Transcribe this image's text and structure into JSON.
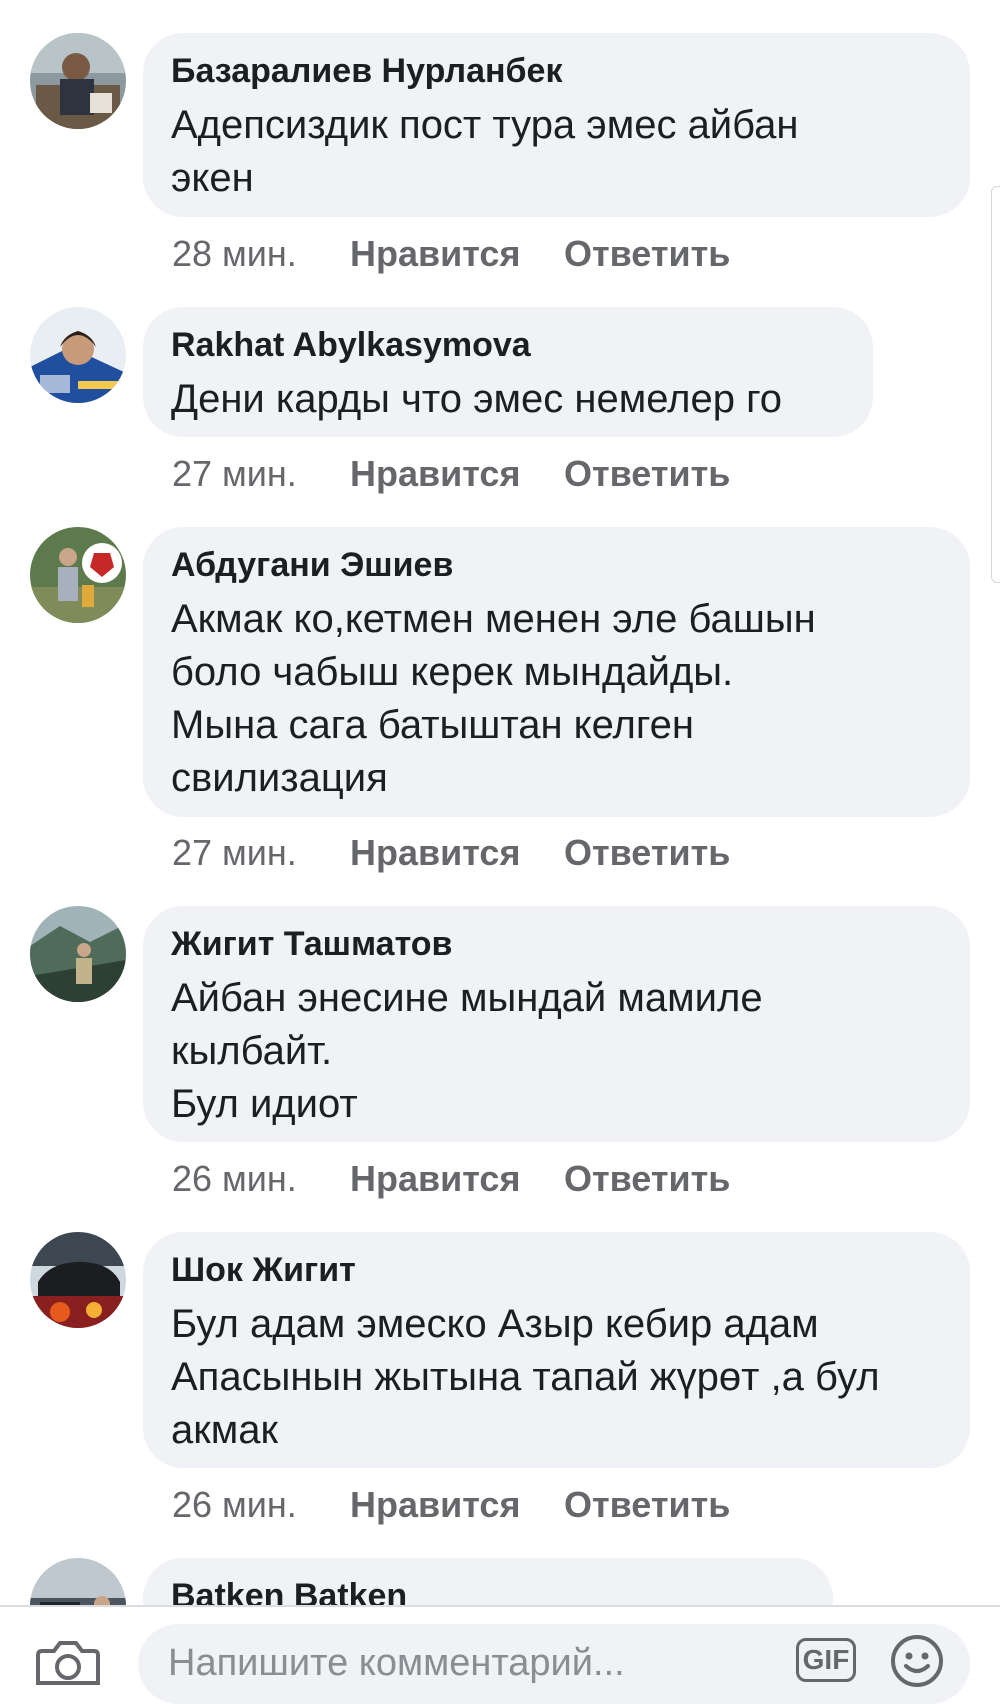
{
  "comments": [
    {
      "author": "Базаралиев Нурланбек",
      "lines": [
        "Адепсиздик пост тура эмес айбан",
        "экен"
      ],
      "time": "28 мин.",
      "like_label": "Нравится",
      "reply_label": "Ответить"
    },
    {
      "author": "Rakhat Abylkasymova",
      "lines": [
        "Дени карды что эмес немелер го"
      ],
      "time": "27 мин.",
      "like_label": "Нравится",
      "reply_label": "Ответить"
    },
    {
      "author": "Абдугани Эшиев",
      "lines": [
        "Акмак ко,кетмен менен эле башын",
        "боло чабыш керек мындайды.",
        "Мына сага батыштан келген",
        "свилизация"
      ],
      "time": "27 мин.",
      "like_label": "Нравится",
      "reply_label": "Ответить"
    },
    {
      "author": "Жигит Ташматов",
      "lines": [
        "Айбан энесине мындай мамиле",
        "кылбайт.",
        "Бул идиот"
      ],
      "time": "26 мин.",
      "like_label": "Нравится",
      "reply_label": "Ответить"
    },
    {
      "author": "Шок Жигит",
      "lines": [
        "Бул адам эмеско Азыр кебир адам",
        "Апасынын жытына тапай жүрөт ,а бул",
        "акмак"
      ],
      "time": "26 мин.",
      "like_label": "Нравится",
      "reply_label": "Ответить"
    },
    {
      "author": "Batken Batken",
      "lines": [],
      "time": "",
      "like_label": "",
      "reply_label": ""
    }
  ],
  "composer": {
    "placeholder": "Напишите комментарий...",
    "gif_label": "GIF",
    "camera_icon": "camera-icon",
    "emoji_icon": "smiley-icon"
  },
  "colors": {
    "bubble": "#f0f2f5",
    "meta_text": "#65676b",
    "text": "#1c1e21"
  }
}
